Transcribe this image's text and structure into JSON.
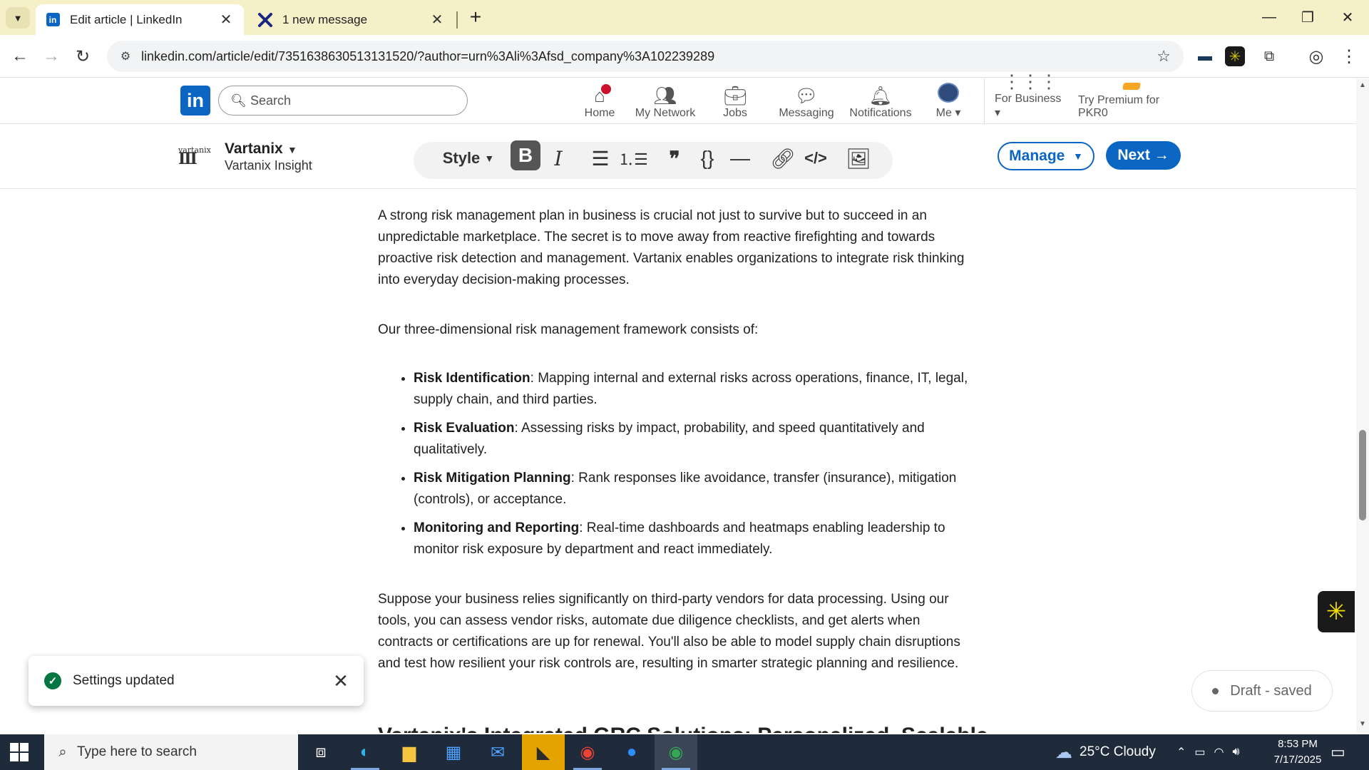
{
  "browser": {
    "tabs": [
      {
        "title": "Edit article | LinkedIn",
        "favicon": "linkedin-icon",
        "active": true
      },
      {
        "title": "1 new message",
        "favicon": "x-icon",
        "active": false
      }
    ],
    "url": "linkedin.com/article/edit/7351638630513131520/?author=urn%3Ali%3Afsd_company%3A102239289"
  },
  "linkedin_nav": {
    "search_placeholder": "Search",
    "items": [
      {
        "label": "Home",
        "icon": "home-icon"
      },
      {
        "label": "My Network",
        "icon": "network-icon"
      },
      {
        "label": "Jobs",
        "icon": "jobs-icon"
      },
      {
        "label": "Messaging",
        "icon": "messaging-icon"
      },
      {
        "label": "Notifications",
        "icon": "bell-icon"
      },
      {
        "label": "Me",
        "icon": "avatar"
      }
    ],
    "for_business": "For Business",
    "premium": "Try Premium for PKR0"
  },
  "editor": {
    "org_logo_text": "vartanix",
    "org_name": "Vartanix",
    "org_sub": "Vartanix Insight",
    "style_label": "Style",
    "manage_label": "Manage",
    "next_label": "Next"
  },
  "article": {
    "p1": "A strong risk management plan in business is crucial not just to survive but to succeed in an unpredictable marketplace. The secret is to move away from reactive firefighting and towards proactive risk detection and management. Vartanix enables organizations to integrate risk thinking into everyday decision-making processes.",
    "p2": "Our three-dimensional risk management framework consists of:",
    "bullets": [
      {
        "term": "Risk Identification",
        "text": ": Mapping internal and external risks across operations, finance, IT, legal, supply chain, and third parties."
      },
      {
        "term": "Risk Evaluation",
        "text": ": Assessing risks by impact, probability, and speed quantitatively and qualitatively."
      },
      {
        "term": "Risk Mitigation Planning",
        "text": ": Rank responses like avoidance, transfer (insurance), mitigation (controls), or acceptance."
      },
      {
        "term": "Monitoring and Reporting",
        "text": ": Real-time dashboards and heatmaps enabling leadership to monitor risk exposure by department and react immediately."
      }
    ],
    "p3": "Suppose your business relies significantly on third-party vendors for data processing. Using our tools, you can assess vendor risks, automate due diligence checklists, and get alerts when contracts or certifications are up for renewal. You'll also be able to model supply chain disruptions and test how resilient your risk controls are, resulting in smarter strategic planning and resilience.",
    "next_heading": "Vartanix's Integrated GRC Solutions: Personalized, Scalable"
  },
  "toast": {
    "message": "Settings updated"
  },
  "draft_status": "Draft - saved",
  "taskbar": {
    "search_placeholder": "Type here to search",
    "weather": "25°C  Cloudy",
    "time": "8:53 PM",
    "date": "7/17/2025"
  },
  "colors": {
    "linkedin_blue": "#0a66c2",
    "tab_strip": "#f6f0c8",
    "taskbar": "#1f2a3b"
  }
}
